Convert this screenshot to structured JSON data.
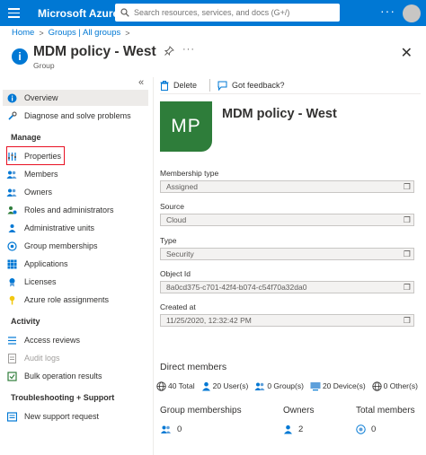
{
  "topbar": {
    "brand": "Microsoft Azure",
    "search_placeholder": "Search resources, services, and docs (G+/)",
    "more": "···"
  },
  "breadcrumb": {
    "items": [
      "Home",
      "Groups | All groups"
    ],
    "sep": ">"
  },
  "header": {
    "title": "MDM policy - West",
    "subtitle": "Group",
    "more": "···",
    "close": "✕"
  },
  "sidebar": {
    "collapse": "«",
    "items": [
      {
        "label": "Overview",
        "icon": "info-icon"
      },
      {
        "label": "Diagnose and solve problems",
        "icon": "wrench-icon"
      }
    ],
    "sections": [
      {
        "title": "Manage",
        "items": [
          {
            "label": "Properties",
            "icon": "properties-icon"
          },
          {
            "label": "Members",
            "icon": "members-icon"
          },
          {
            "label": "Owners",
            "icon": "owners-icon"
          },
          {
            "label": "Roles and administrators",
            "icon": "roles-icon"
          },
          {
            "label": "Administrative units",
            "icon": "admin-units-icon"
          },
          {
            "label": "Group memberships",
            "icon": "group-memberships-icon"
          },
          {
            "label": "Applications",
            "icon": "applications-icon"
          },
          {
            "label": "Licenses",
            "icon": "licenses-icon"
          },
          {
            "label": "Azure role assignments",
            "icon": "key-icon"
          }
        ]
      },
      {
        "title": "Activity",
        "items": [
          {
            "label": "Access reviews",
            "icon": "access-reviews-icon"
          },
          {
            "label": "Audit logs",
            "icon": "audit-logs-icon"
          },
          {
            "label": "Bulk operation results",
            "icon": "bulk-operations-icon"
          }
        ]
      },
      {
        "title": "Troubleshooting + Support",
        "items": [
          {
            "label": "New support request",
            "icon": "support-icon"
          }
        ]
      }
    ]
  },
  "toolbar": {
    "delete": "Delete",
    "feedback": "Got feedback?"
  },
  "overview": {
    "initials": "MP",
    "name": "MDM policy - West",
    "fields": [
      {
        "label": "Membership type",
        "value": "Assigned"
      },
      {
        "label": "Source",
        "value": "Cloud"
      },
      {
        "label": "Type",
        "value": "Security"
      },
      {
        "label": "Object Id",
        "value": "8a0cd375-c701-42f4-b074-c54f70a32da0"
      },
      {
        "label": "Created at",
        "value": "11/25/2020, 12:32:42 PM"
      }
    ],
    "direct_members_title": "Direct members",
    "counts": [
      {
        "text": "40 Total",
        "icon": "globe-icon"
      },
      {
        "text": "20 User(s)",
        "icon": "user-icon"
      },
      {
        "text": "0 Group(s)",
        "icon": "group-icon"
      },
      {
        "text": "20 Device(s)",
        "icon": "device-icon"
      },
      {
        "text": "0 Other(s)",
        "icon": "globe-icon"
      }
    ],
    "stats": [
      {
        "label": "Group memberships",
        "value": "0",
        "icon": "group-icon"
      },
      {
        "label": "Owners",
        "value": "2",
        "icon": "user-icon"
      },
      {
        "label": "Total members",
        "value": "0",
        "icon": "total-members-icon"
      }
    ]
  },
  "colors": {
    "azure_blue": "#0078d4",
    "tile_green": "#2e7d3a",
    "highlight_red": "#e81123"
  }
}
